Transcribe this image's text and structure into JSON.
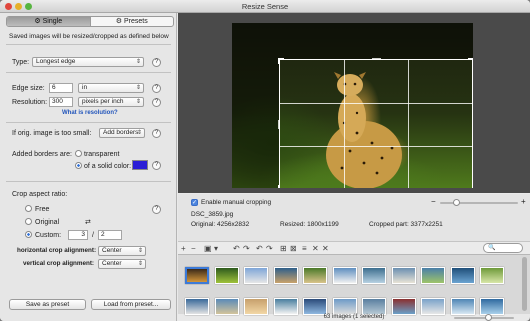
{
  "window": {
    "title": "Resize Sense"
  },
  "tabs": {
    "single": "Single",
    "presets": "Presets"
  },
  "intro": "Saved images will be resized/cropped as defined below",
  "type": {
    "label": "Type:",
    "value": "Longest edge"
  },
  "edge": {
    "label": "Edge size:",
    "value": "6",
    "unit": "in"
  },
  "resolution": {
    "label": "Resolution:",
    "value": "300",
    "unit": "pixels per inch",
    "link": "What is resolution?"
  },
  "small": {
    "label": "If orig. image is too small:",
    "value": "Add borders"
  },
  "borders": {
    "label": "Added borders are:",
    "option1": "transparent",
    "option2": "of a solid color:",
    "color": "#2b1fd6"
  },
  "crop": {
    "label": "Crop aspect ratio:",
    "free": "Free",
    "original": "Original",
    "swap": "⇄",
    "custom": "Custom:",
    "w": "3",
    "slash": "/",
    "h": "2",
    "h_align_label": "horizontal crop alignment:",
    "h_align": "Center",
    "v_align_label": "vertical crop alignment:",
    "v_align": "Center"
  },
  "buttons": {
    "save": "Save as preset",
    "load": "Load from preset..."
  },
  "help": "?",
  "preview": {
    "manual_label": "Enable manual cropping",
    "manual_checked": "✓",
    "filename": "DSC_3859.jpg",
    "original": "Original: 4256x2832",
    "resized": "Resized: 1800x1199",
    "cropped": "Cropped part: 3377x2251",
    "zoom": 0.18
  },
  "toolbar": {
    "icons": [
      "+",
      "−",
      "▣",
      "▾",
      "↶",
      "↷",
      "↶",
      "↷",
      "⊞",
      "⊠",
      "≡",
      "✕",
      "✕"
    ],
    "search_placeholder": "🔍"
  },
  "status": "63 images (1 selected)",
  "thumb_size": 0.55,
  "colors": {
    "accent": "#2d6fd8",
    "link": "#2255bb",
    "preview_bg": "#4a4a4a"
  }
}
